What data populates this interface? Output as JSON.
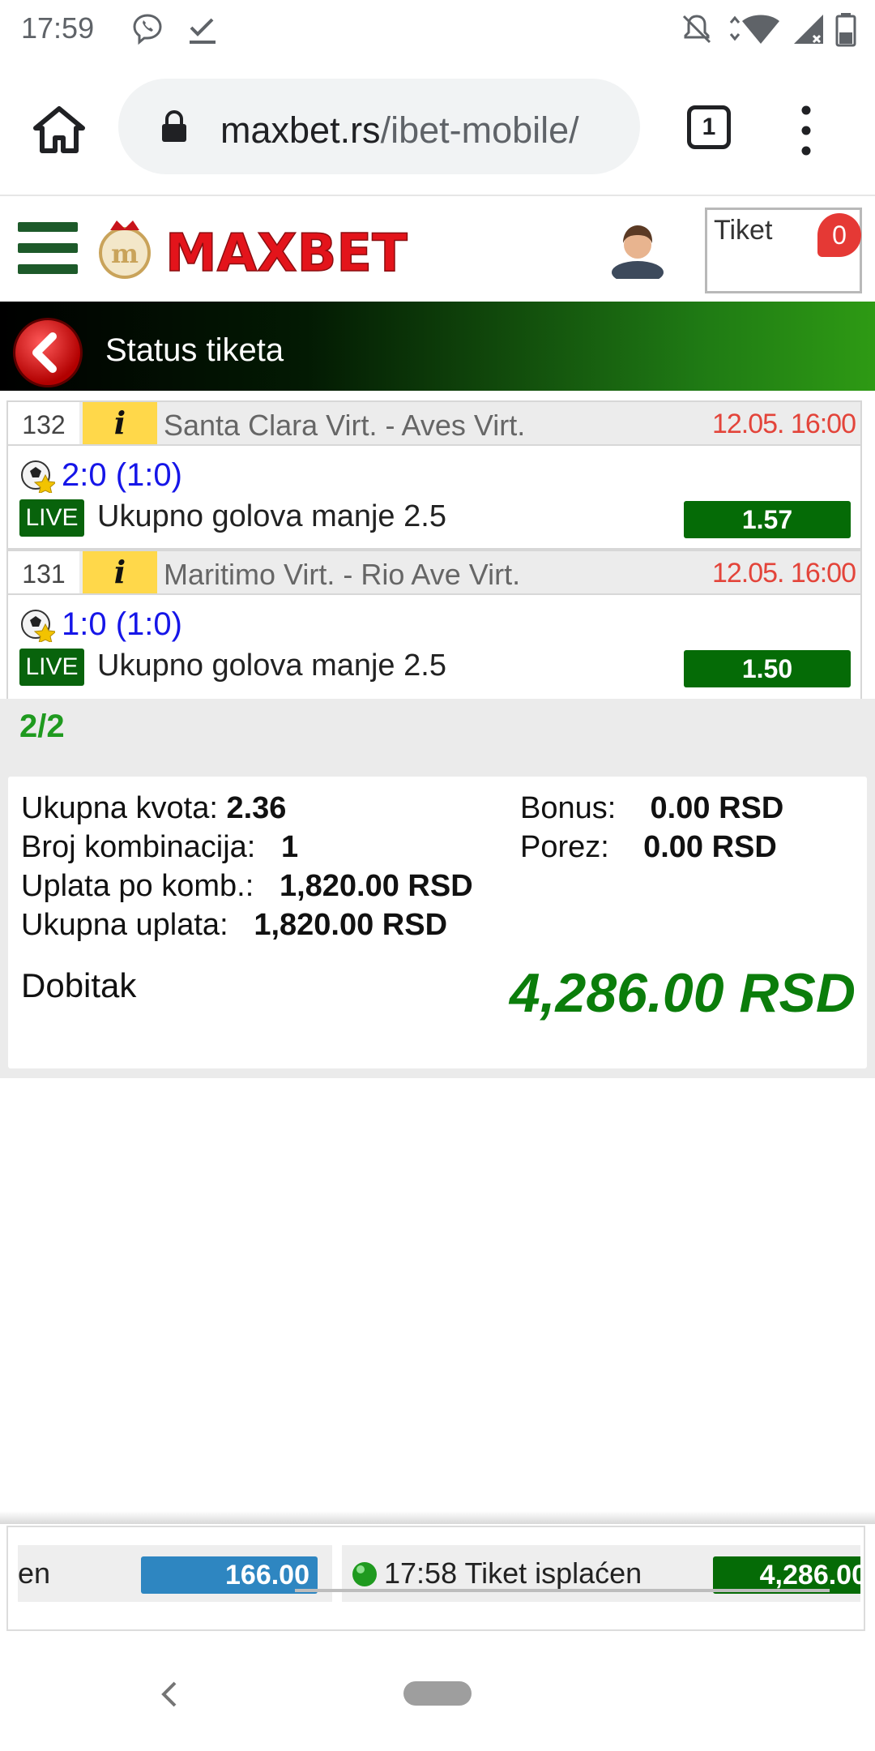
{
  "status_bar": {
    "time": "17:59"
  },
  "browser": {
    "url_domain": "maxbet.rs",
    "url_path": "/ibet-mobile/",
    "tab_count": "1"
  },
  "header": {
    "logo_text": "MAXBET",
    "ticket_label": "Tiket",
    "ticket_count": "0"
  },
  "page": {
    "title": "Status tiketa"
  },
  "matches": [
    {
      "number": "132",
      "info": "i",
      "teams": "Santa Clara Virt. - Aves Virt.",
      "datetime": "12.05. 16:00",
      "score": "2:0 (1:0)",
      "live_label": "LIVE",
      "bet": "Ukupno golova manje 2.5",
      "odd": "1.57"
    },
    {
      "number": "131",
      "info": "i",
      "teams": "Maritimo Virt. - Rio Ave Virt.",
      "datetime": "12.05. 16:00",
      "score": "1:0 (1:0)",
      "live_label": "LIVE",
      "bet": "Ukupno golova manje 2.5",
      "odd": "1.50"
    }
  ],
  "count": "2/2",
  "summary": {
    "total_odds_label": "Ukupna kvota:",
    "total_odds": "2.36",
    "combinations_label": "Broj kombinacija:",
    "combinations": "1",
    "stake_per_comb_label": "Uplata po komb.:",
    "stake_per_comb": "1,820.00 RSD",
    "total_stake_label": "Ukupna uplata:",
    "total_stake": "1,820.00 RSD",
    "bonus_label": "Bonus:",
    "bonus": "0.00 RSD",
    "tax_label": "Porez:",
    "tax": "0.00 RSD",
    "payout_label": "Dobitak",
    "payout": "4,286.00 RSD"
  },
  "ticker": {
    "item1_text": "en",
    "item1_amount": "166.00",
    "item2_text": "17:58 Tiket isplaćen",
    "item2_amount": "4,286.00"
  },
  "colors": {
    "brand_red": "#e3141b",
    "brand_green": "#056b06",
    "score_blue": "#1616e8",
    "payout_green": "#0b7d0b",
    "date_red": "#e3443a"
  }
}
